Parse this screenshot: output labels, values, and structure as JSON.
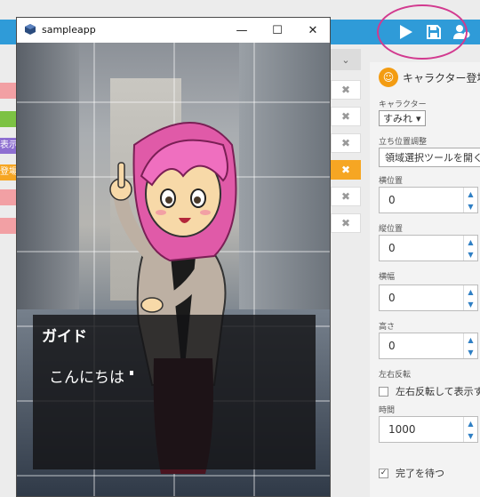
{
  "toolbar": {
    "play_icon": "play-icon",
    "save_icon": "save-icon",
    "users_icon": "users-gear-icon",
    "accent_color": "#2f9bd8",
    "highlight_color": "#d23a8f"
  },
  "left_strip": {
    "labels": [
      "",
      "",
      "表示",
      "登場",
      "",
      ""
    ]
  },
  "middle_list": {
    "header_icon": "chevron-down-icon",
    "row_icons": [
      "close-icon",
      "close-icon",
      "close-icon",
      "close-icon",
      "close-icon",
      "close-icon"
    ],
    "active_row_color": "#f6a623"
  },
  "right_panel": {
    "title": "キャラクター登場",
    "character_label": "キャラクター",
    "character_value": "すみれ",
    "position_label": "立ち位置調整",
    "region_button": "領域選択ツールを開く",
    "x_label": "横位置",
    "x_value": "0",
    "y_label": "縦位置",
    "y_value": "0",
    "width_label": "横幅",
    "width_value": "0",
    "height_label": "高さ",
    "height_value": "0",
    "flip_label": "左右反転",
    "flip_checkbox_label": "左右反転して表示す",
    "time_label": "時間",
    "time_value": "1000",
    "wait_label": "完了を待つ"
  },
  "app_window": {
    "title": "sampleapp",
    "minimize_glyph": "—",
    "maximize_glyph": "☐",
    "close_glyph": "✕",
    "speaker_name": "ガイド",
    "message": "こんにちは"
  }
}
